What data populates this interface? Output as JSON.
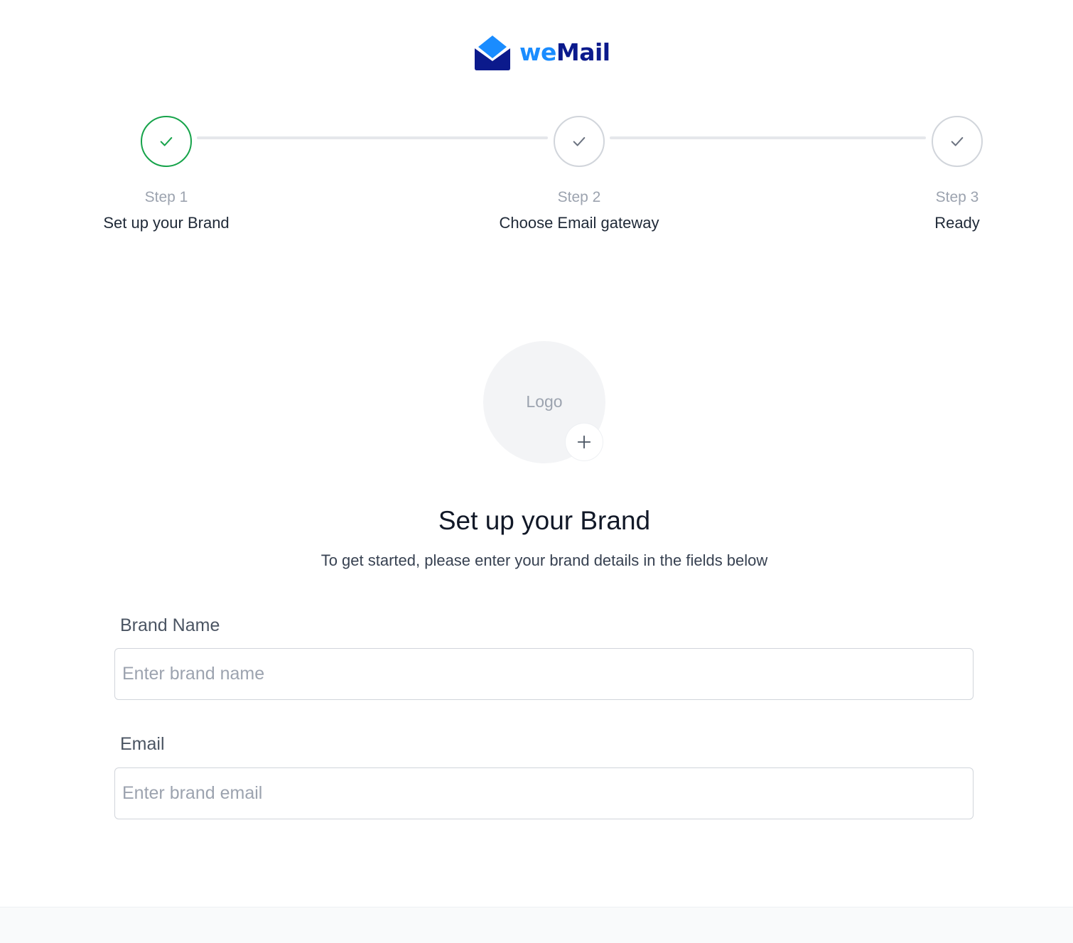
{
  "brand": {
    "name_part1": "we",
    "name_part2": "Mail"
  },
  "stepper": {
    "steps": [
      {
        "title": "Step 1",
        "label": "Set up your Brand",
        "status": "active"
      },
      {
        "title": "Step 2",
        "label": "Choose Email gateway",
        "status": "pending"
      },
      {
        "title": "Step 3",
        "label": "Ready",
        "status": "pending"
      }
    ]
  },
  "logo_upload": {
    "label": "Logo"
  },
  "main": {
    "heading": "Set up your Brand",
    "subheading": "To get started, please enter your brand details in the fields below"
  },
  "form": {
    "brand_name": {
      "label": "Brand Name",
      "placeholder": "Enter brand name",
      "value": ""
    },
    "email": {
      "label": "Email",
      "placeholder": "Enter brand email",
      "value": ""
    }
  },
  "colors": {
    "active_step": "#16a34a",
    "inactive_step": "#d1d5db",
    "brand_light": "#1a8cff",
    "brand_dark": "#0b1a8c"
  }
}
